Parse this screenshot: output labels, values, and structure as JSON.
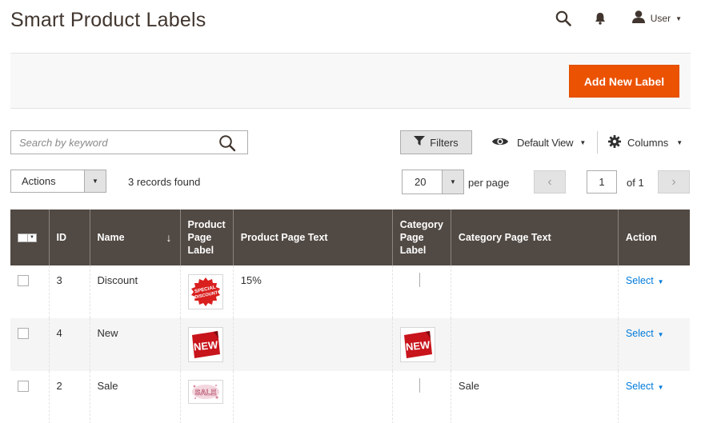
{
  "page": {
    "title": "Smart Product Labels"
  },
  "header": {
    "user_name": "User"
  },
  "action_bar": {
    "add_label": "Add New Label"
  },
  "search": {
    "placeholder": "Search by keyword"
  },
  "toolbar": {
    "filters_label": "Filters",
    "view_label": "Default View",
    "columns_label": "Columns",
    "actions_label": "Actions",
    "records_found": "3 records found",
    "per_page_value": "20",
    "per_page_label": "per page",
    "current_page": "1",
    "page_of": "of 1"
  },
  "grid": {
    "columns": {
      "id": "ID",
      "name": "Name",
      "product_label_l1": "Product",
      "product_label_l2": "Page",
      "product_label_l3": "Label",
      "product_text": "Product Page Text",
      "category_label_l1": "Category",
      "category_label_l2": "Page",
      "category_label_l3": "Label",
      "category_text": "Category Page Text",
      "action": "Action"
    },
    "rows": [
      {
        "id": "3",
        "name": "Discount",
        "product_image": "special-discount-badge",
        "product_image_text_1": "SPECIAL",
        "product_image_text_2": "DISCOUNT",
        "product_text": "15%",
        "category_image": "",
        "category_text": "",
        "action": "Select"
      },
      {
        "id": "4",
        "name": "New",
        "product_image": "new-sticker",
        "product_image_text": "NEW",
        "product_text": "",
        "category_image": "new-sticker",
        "category_image_text": "NEW",
        "category_text": "",
        "action": "Select"
      },
      {
        "id": "2",
        "name": "Sale",
        "product_image": "sale-splash",
        "product_image_text": "SALE",
        "product_text": "",
        "category_image": "",
        "category_text": "Sale",
        "action": "Select"
      }
    ]
  },
  "colors": {
    "accent": "#eb5202",
    "header_bg": "#514943",
    "link": "#007bdb",
    "title": "#41362f"
  }
}
